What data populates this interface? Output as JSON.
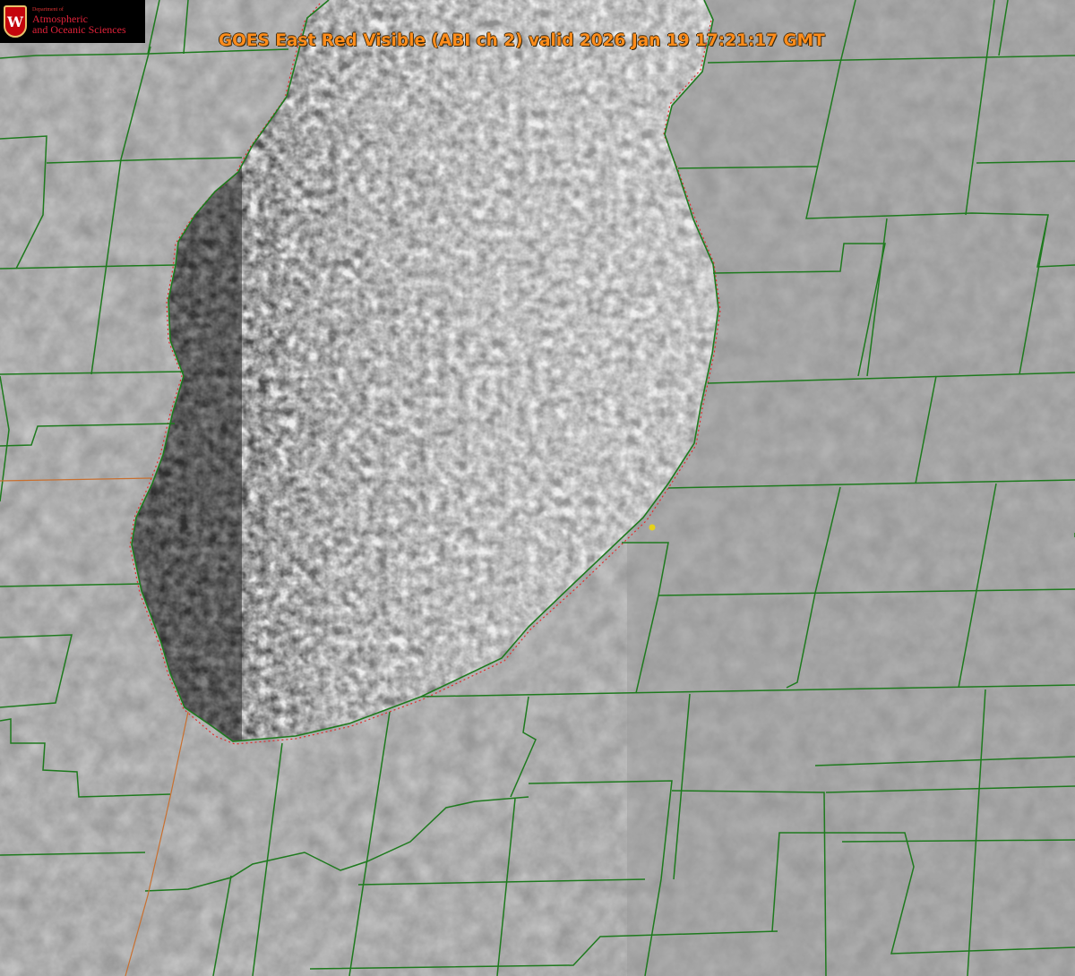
{
  "header": {
    "title": "GOES East Red Visible (ABI ch 2) valid 2026 Jan 19 17:21:17 GMT"
  },
  "logo": {
    "crest_letter": "W",
    "department": "Department of",
    "line1": "Atmospheric",
    "line2": "and Oceanic Sciences",
    "colors": {
      "crest": "#c5050c",
      "text": "#e2223a"
    }
  },
  "map": {
    "image": "satellite-visible-imagery",
    "feature": "Lake Michigan",
    "colors": {
      "county_lines": "#1e7a1e",
      "state_line": "#c87030",
      "shoreline_dotted": "#e03030",
      "title": "#ff8c1a",
      "site_marker": "#e6d21a"
    }
  }
}
